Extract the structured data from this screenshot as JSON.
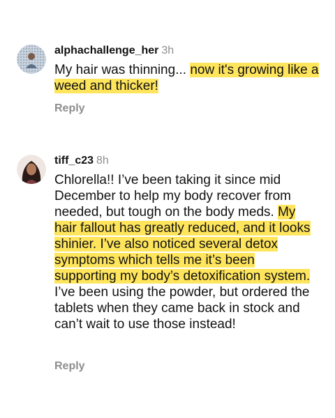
{
  "comments": [
    {
      "username": "alphachallenge_her",
      "time": "3h",
      "text_plain_1": "My hair was thinning... ",
      "text_highlight_1": "now it's growing like a weed and thicker!",
      "reply_label": "Reply",
      "avatar_icon": "user-avatar-icon"
    },
    {
      "username": "tiff_c23",
      "time": "8h",
      "text_plain_1": "Chlorella!! I’ve been taking it since mid December to help my body recover from needed, but tough on the body meds. ",
      "text_highlight_1": "My hair fallout has greatly reduced, and it looks shinier. I’ve also noticed several detox symptoms which tells me it’s been supporting my body’s detoxification system.",
      "text_plain_2": " I’ve been using the powder, but ordered the tablets when they came back in stock and can’t wait to use those instead!",
      "reply_label": "Reply",
      "avatar_icon": "user-avatar-icon"
    }
  ],
  "colors": {
    "highlight": "#ffe55c",
    "muted": "#8e8e8e",
    "text": "#111111"
  }
}
